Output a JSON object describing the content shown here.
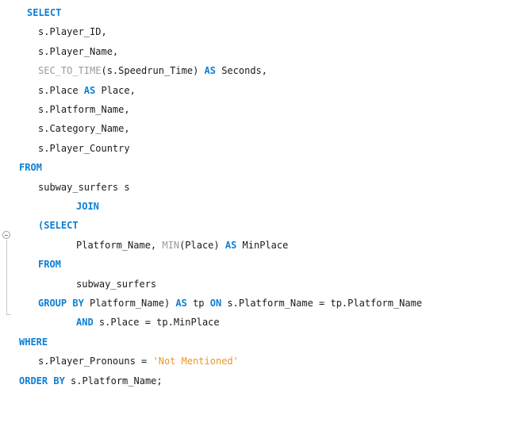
{
  "editor": {
    "lines": [
      {
        "indent": 34,
        "tokens": [
          {
            "t": "kw",
            "text": "SELECT"
          }
        ]
      },
      {
        "indent": 48,
        "tokens": [
          {
            "t": "plain",
            "text": "s.Player_ID,"
          }
        ]
      },
      {
        "indent": 48,
        "tokens": [
          {
            "t": "plain",
            "text": "s.Player_Name,"
          }
        ]
      },
      {
        "indent": 48,
        "tokens": [
          {
            "t": "fn",
            "text": "SEC_TO_TIME"
          },
          {
            "t": "plain",
            "text": "(s.Speedrun_Time) "
          },
          {
            "t": "kw",
            "text": "AS"
          },
          {
            "t": "plain",
            "text": " Seconds,"
          }
        ]
      },
      {
        "indent": 48,
        "tokens": [
          {
            "t": "plain",
            "text": "s.Place "
          },
          {
            "t": "kw",
            "text": "AS"
          },
          {
            "t": "plain",
            "text": " Place,"
          }
        ]
      },
      {
        "indent": 48,
        "tokens": [
          {
            "t": "plain",
            "text": "s.Platform_Name,"
          }
        ]
      },
      {
        "indent": 48,
        "tokens": [
          {
            "t": "plain",
            "text": "s.Category_Name,"
          }
        ]
      },
      {
        "indent": 48,
        "tokens": [
          {
            "t": "plain",
            "text": "s.Player_Country"
          }
        ]
      },
      {
        "indent": 24,
        "tokens": [
          {
            "t": "kw",
            "text": "FROM"
          }
        ]
      },
      {
        "indent": 48,
        "tokens": [
          {
            "t": "plain",
            "text": "subway_surfers s"
          }
        ]
      },
      {
        "indent": 96,
        "tokens": [
          {
            "t": "kw",
            "text": "JOIN"
          }
        ]
      },
      {
        "indent": 48,
        "tokens": [
          {
            "t": "kw",
            "text": "(SELECT"
          }
        ]
      },
      {
        "indent": 96,
        "tokens": [
          {
            "t": "plain",
            "text": "Platform_Name, "
          },
          {
            "t": "fn",
            "text": "MIN"
          },
          {
            "t": "plain",
            "text": "(Place) "
          },
          {
            "t": "kw",
            "text": "AS"
          },
          {
            "t": "plain",
            "text": " MinPlace"
          }
        ]
      },
      {
        "indent": 48,
        "tokens": [
          {
            "t": "kw",
            "text": "FROM"
          }
        ]
      },
      {
        "indent": 96,
        "tokens": [
          {
            "t": "plain",
            "text": "subway_surfers"
          }
        ]
      },
      {
        "indent": 48,
        "tokens": [
          {
            "t": "kw",
            "text": "GROUP BY"
          },
          {
            "t": "plain",
            "text": " Platform_Name) "
          },
          {
            "t": "kw",
            "text": "AS"
          },
          {
            "t": "plain",
            "text": " tp "
          },
          {
            "t": "kw",
            "text": "ON"
          },
          {
            "t": "plain",
            "text": " s.Platform_Name = tp.Platform_Name"
          }
        ]
      },
      {
        "indent": 96,
        "tokens": [
          {
            "t": "kw",
            "text": "AND"
          },
          {
            "t": "plain",
            "text": " s.Place = tp.MinPlace"
          }
        ]
      },
      {
        "indent": 24,
        "tokens": [
          {
            "t": "kw",
            "text": "WHERE"
          }
        ]
      },
      {
        "indent": 48,
        "tokens": [
          {
            "t": "plain",
            "text": "s.Player_Pronouns = "
          },
          {
            "t": "str",
            "text": "'Not Mentioned'"
          }
        ]
      },
      {
        "indent": 24,
        "tokens": [
          {
            "t": "kw",
            "text": "ORDER BY"
          },
          {
            "t": "plain",
            "text": " s.Platform_Name;"
          }
        ]
      }
    ]
  },
  "colors": {
    "keyword": "#0b7fd6",
    "function": "#9a9a9a",
    "string": "#f0932b",
    "text": "#1a1a1a",
    "background": "#ffffff"
  },
  "icons": {
    "fold_toggle": "collapse-minus-icon"
  }
}
